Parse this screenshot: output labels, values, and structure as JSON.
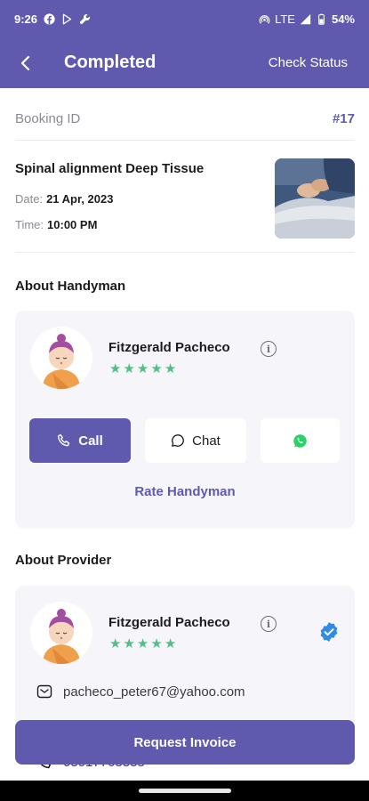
{
  "status_bar": {
    "time": "9:26",
    "network": "LTE",
    "battery": "54%",
    "icons": [
      "facebook-icon",
      "play-store-icon",
      "wrench-icon",
      "hotspot-icon",
      "signal-icon",
      "battery-icon"
    ]
  },
  "app_bar": {
    "title": "Completed",
    "action_label": "Check Status",
    "color": "#5f5aad"
  },
  "booking": {
    "label": "Booking ID",
    "id": "#17"
  },
  "service": {
    "name": "Spinal alignment Deep Tissue",
    "date_label": "Date:",
    "date_value": "21 Apr, 2023",
    "time_label": "Time:",
    "time_value": "10:00 PM"
  },
  "handyman": {
    "section_title": "About Handyman",
    "name": "Fitzgerald Pacheco",
    "rating": 5,
    "call_label": "Call",
    "chat_label": "Chat",
    "rate_label": "Rate Handyman"
  },
  "provider": {
    "section_title": "About Provider",
    "name": "Fitzgerald Pacheco",
    "rating": 5,
    "email": "pacheco_peter67@yahoo.com",
    "phone_partial": "08017768888"
  },
  "footer": {
    "invoice_label": "Request Invoice"
  },
  "colors": {
    "primary": "#5f5aad",
    "star": "#4fbf84",
    "whatsapp": "#25d366",
    "verified": "#2f8be6"
  }
}
